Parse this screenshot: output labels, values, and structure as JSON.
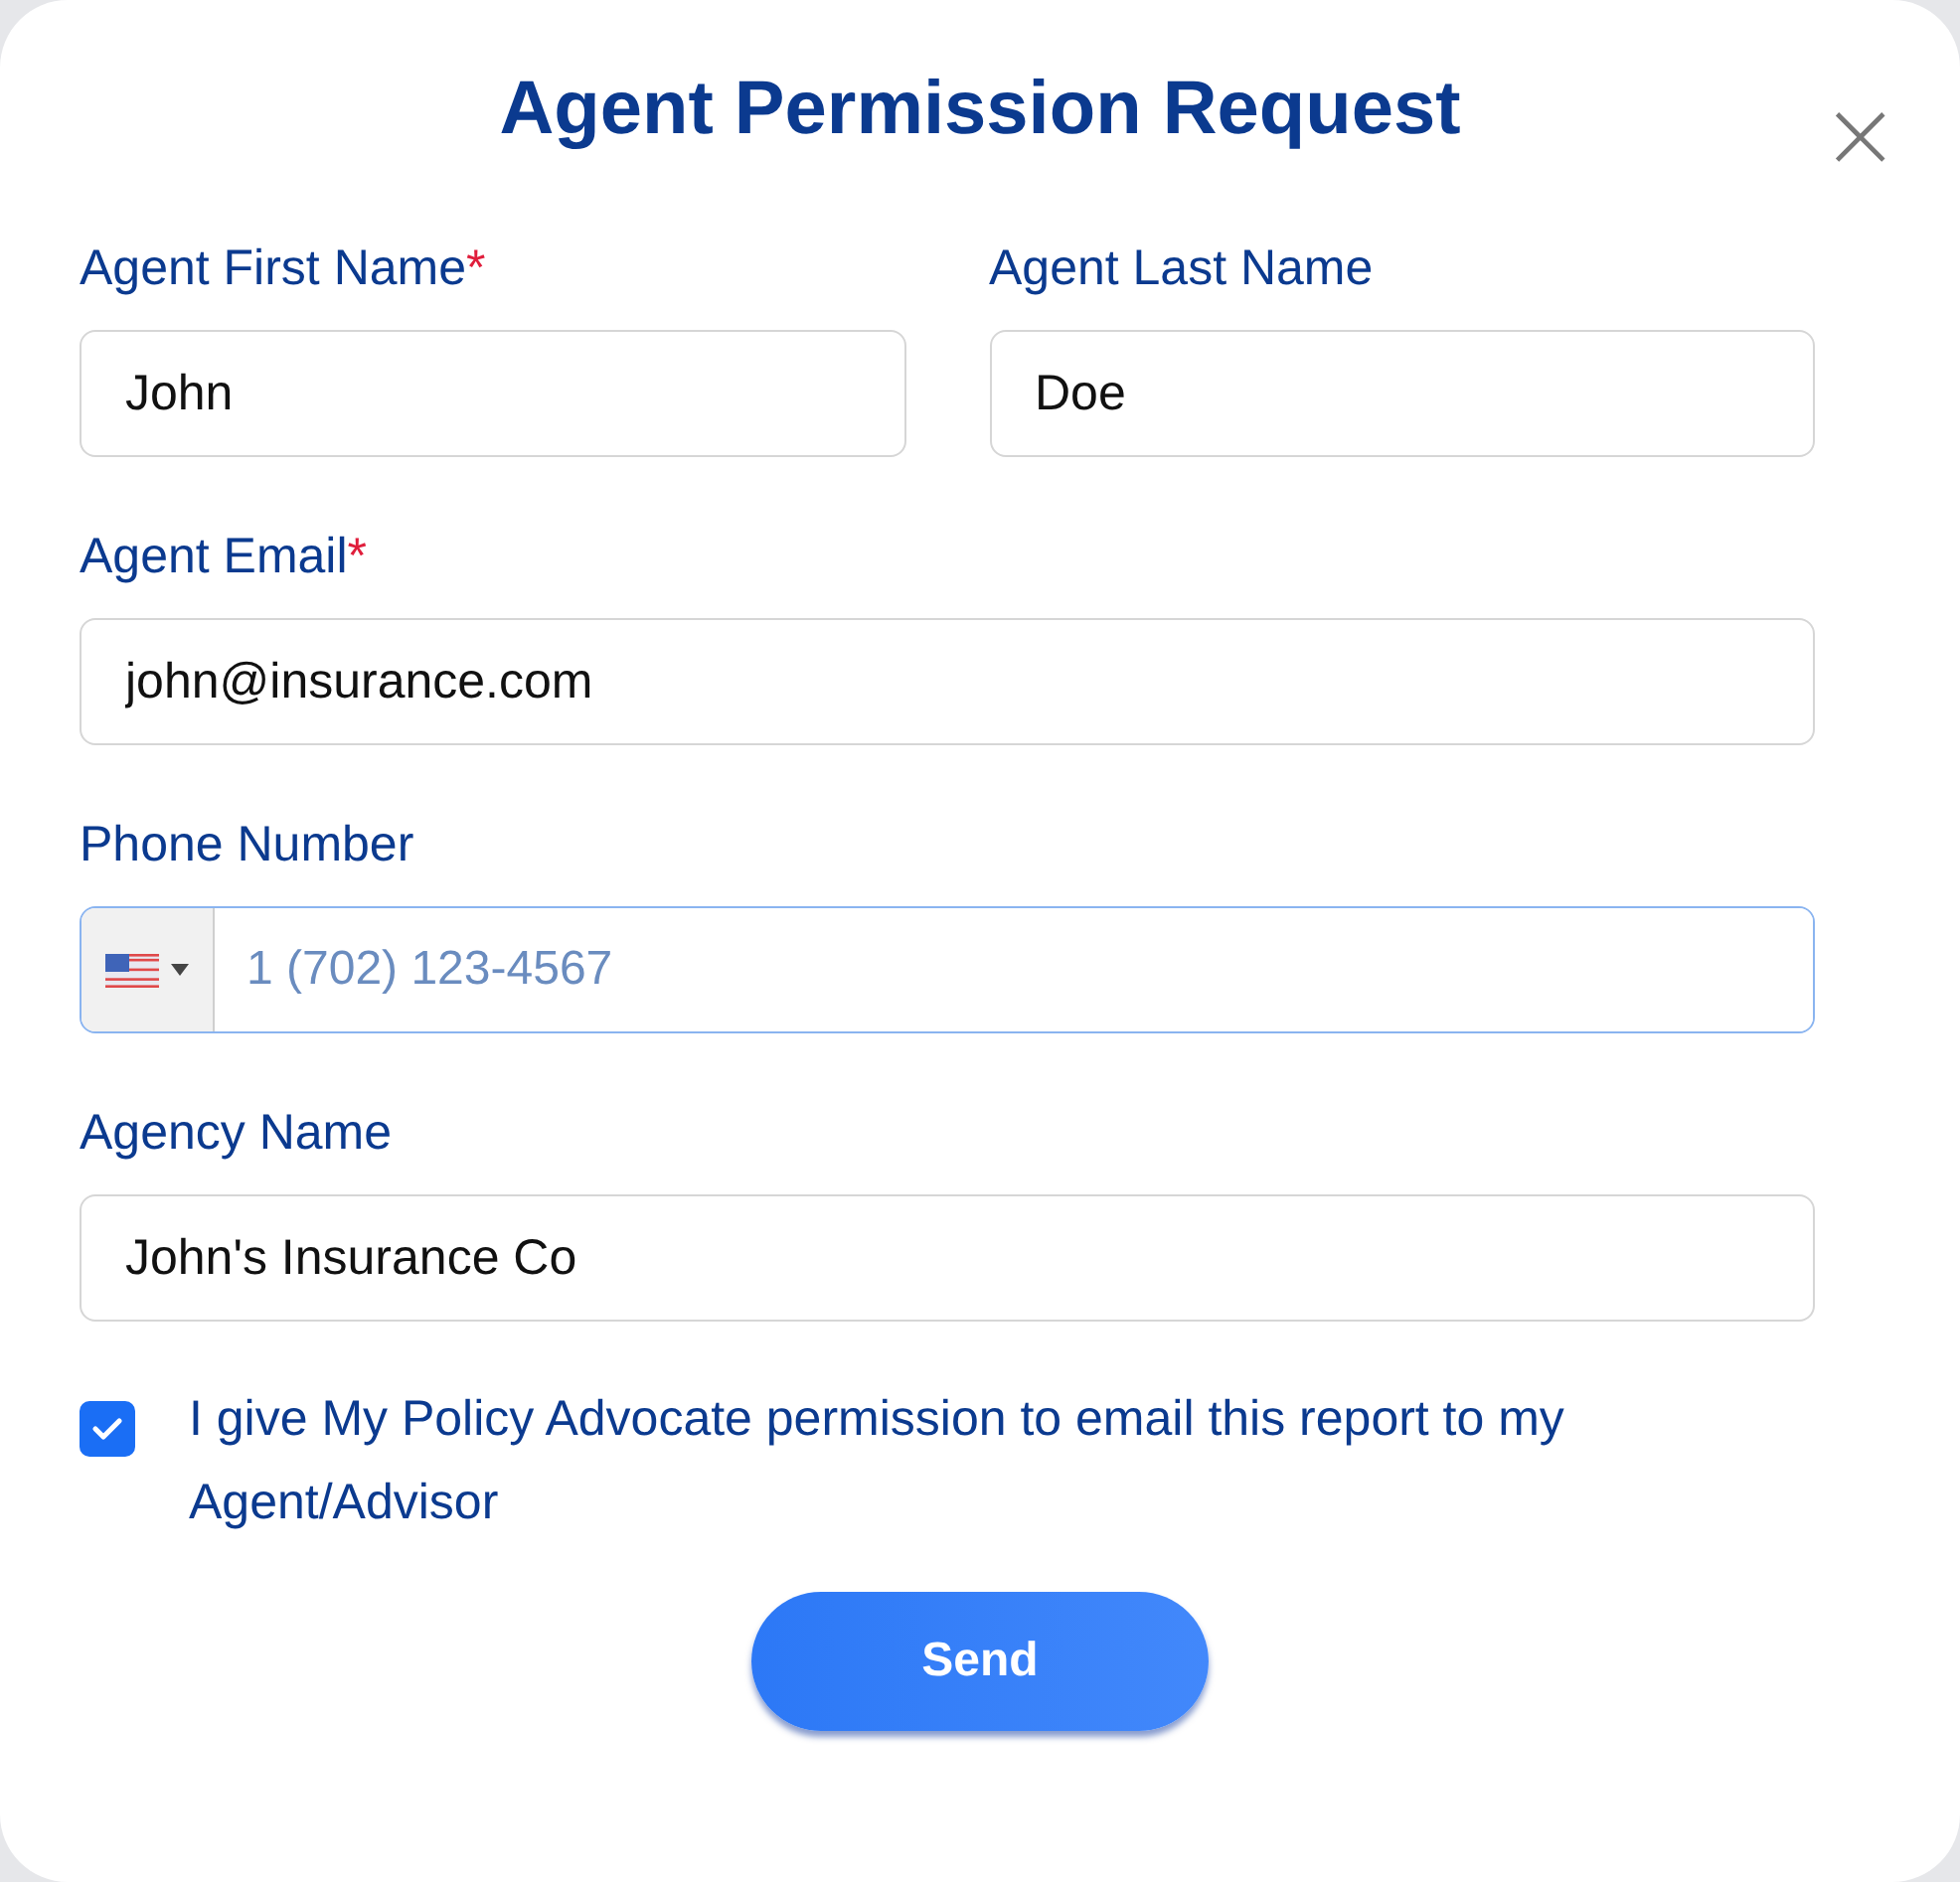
{
  "title": "Agent Permission Request",
  "close": {
    "symbol": "×"
  },
  "rows": [
    [
      {
        "kind": "text",
        "label": "Agent First Name",
        "required_mark": "*",
        "value": "John"
      },
      {
        "kind": "text",
        "label": "Agent Last Name",
        "value": "Doe"
      }
    ],
    [
      {
        "kind": "text",
        "label": "Agent Email",
        "required_mark": "*",
        "value": "john@insurance.com"
      }
    ],
    [
      {
        "kind": "phone",
        "label": "Phone Number",
        "placeholder": "1 (702) 123-4567",
        "focused": true
      }
    ],
    [
      {
        "kind": "text",
        "label": "Agency Name",
        "value": "John's Insurance Co"
      }
    ]
  ],
  "consent": {
    "checked": true,
    "text": "I give My Policy Advocate permission to email this report to my Agent/Advisor"
  },
  "submit": {
    "label": "Send"
  }
}
